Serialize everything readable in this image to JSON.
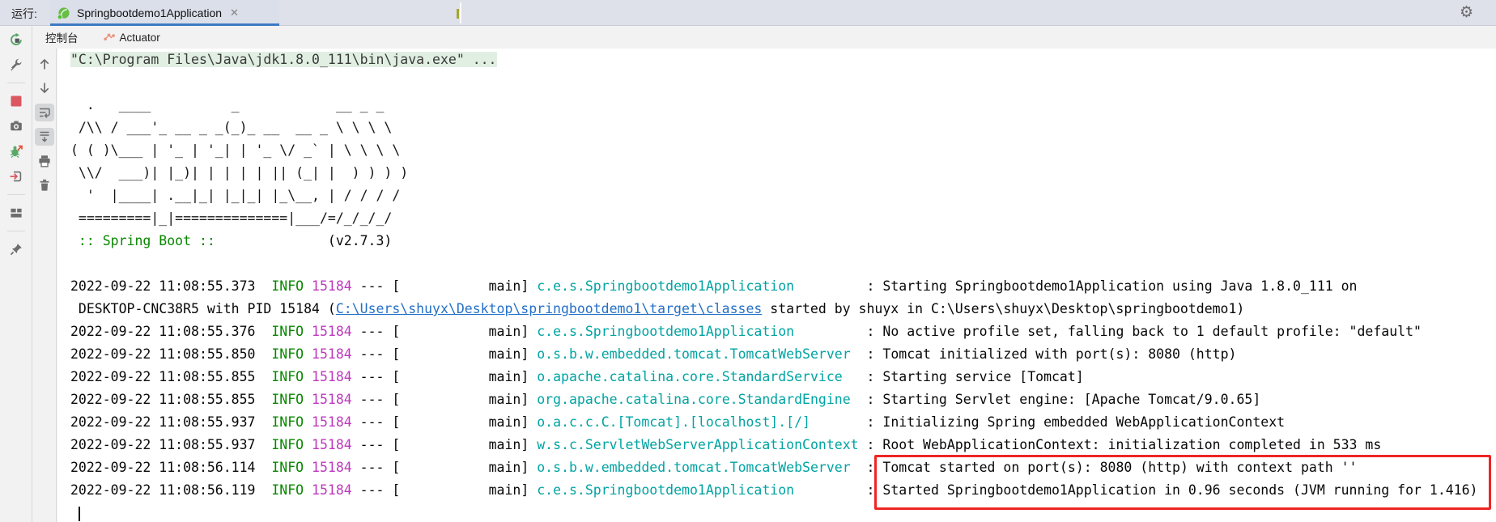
{
  "header": {
    "run_label": "运行:",
    "tab": {
      "title": "Springbootdemo1Application",
      "close_glyph": "✕"
    }
  },
  "icons": {
    "gear_glyph": "⚙"
  },
  "view_tabs": [
    {
      "label": "控制台",
      "active": true
    },
    {
      "label": "Actuator",
      "active": false
    }
  ],
  "colors": {
    "tab_underline": "#3e7ac2",
    "info_green": "#098700",
    "pid_magenta": "#bd38bd",
    "logger_teal": "#00a3a3",
    "link_blue": "#2470c8",
    "annotation_red": "#ee2524",
    "stop_red": "#db5860",
    "run_green": "#59a869",
    "actuator_salmon": "#e8927c"
  },
  "console": {
    "command_line": "\"C:\\Program Files\\Java\\jdk1.8.0_111\\bin\\java.exe\" ...",
    "banner": [
      "  .   ____          _            __ _ _",
      " /\\\\ / ___'_ __ _ _(_)_ __  __ _ \\ \\ \\ \\",
      "( ( )\\___ | '_ | '_| | '_ \\/ _` | \\ \\ \\ \\",
      " \\\\/  ___)| |_)| | | | | || (_| |  ) ) ) )",
      "  '  |____| .__|_| |_|_| |_\\__, | / / / /",
      " =========|_|==============|___/=/_/_/_/"
    ],
    "banner_footer": {
      "label": " :: Spring Boot ::",
      "version": "(v2.7.3)",
      "version_column": 32
    },
    "log_format": {
      "thread_width": 15,
      "logger_width": 40
    },
    "logs": [
      {
        "timestamp": "2022-09-22 11:08:55.373",
        "level": "INFO",
        "pid": "15184",
        "thread": "main",
        "logger": "c.e.s.Springbootdemo1Application",
        "message": "Starting Springbootdemo1Application using Java 1.8.0_111 on"
      },
      {
        "parts": [
          {
            "text": " DESKTOP-CNC38R5 with PID 15184 ("
          },
          {
            "text": "C:\\Users\\shuyx\\Desktop\\springbootdemo1\\target\\classes",
            "link": true
          },
          {
            "text": " started by shuyx in C:\\Users\\shuyx\\Desktop\\springbootdemo1)"
          }
        ]
      },
      {
        "timestamp": "2022-09-22 11:08:55.376",
        "level": "INFO",
        "pid": "15184",
        "thread": "main",
        "logger": "c.e.s.Springbootdemo1Application",
        "message": "No active profile set, falling back to 1 default profile: \"default\""
      },
      {
        "timestamp": "2022-09-22 11:08:55.850",
        "level": "INFO",
        "pid": "15184",
        "thread": "main",
        "logger": "o.s.b.w.embedded.tomcat.TomcatWebServer",
        "message": "Tomcat initialized with port(s): 8080 (http)"
      },
      {
        "timestamp": "2022-09-22 11:08:55.855",
        "level": "INFO",
        "pid": "15184",
        "thread": "main",
        "logger": "o.apache.catalina.core.StandardService",
        "message": "Starting service [Tomcat]"
      },
      {
        "timestamp": "2022-09-22 11:08:55.855",
        "level": "INFO",
        "pid": "15184",
        "thread": "main",
        "logger": "org.apache.catalina.core.StandardEngine",
        "message": "Starting Servlet engine: [Apache Tomcat/9.0.65]"
      },
      {
        "timestamp": "2022-09-22 11:08:55.937",
        "level": "INFO",
        "pid": "15184",
        "thread": "main",
        "logger": "o.a.c.c.C.[Tomcat].[localhost].[/]",
        "message": "Initializing Spring embedded WebApplicationContext"
      },
      {
        "timestamp": "2022-09-22 11:08:55.937",
        "level": "INFO",
        "pid": "15184",
        "thread": "main",
        "logger": "w.s.c.ServletWebServerApplicationContext",
        "message": "Root WebApplicationContext: initialization completed in 533 ms"
      },
      {
        "timestamp": "2022-09-22 11:08:56.114",
        "level": "INFO",
        "pid": "15184",
        "thread": "main",
        "logger": "o.s.b.w.embedded.tomcat.TomcatWebServer",
        "message": "Tomcat started on port(s): 8080 (http) with context path ''"
      },
      {
        "timestamp": "2022-09-22 11:08:56.119",
        "level": "INFO",
        "pid": "15184",
        "thread": "main",
        "logger": "c.e.s.Springbootdemo1Application",
        "message": "Started Springbootdemo1Application in 0.96 seconds (JVM running for 1.416)"
      }
    ],
    "annotation": {
      "type": "red-box",
      "around": "last two log messages"
    }
  }
}
